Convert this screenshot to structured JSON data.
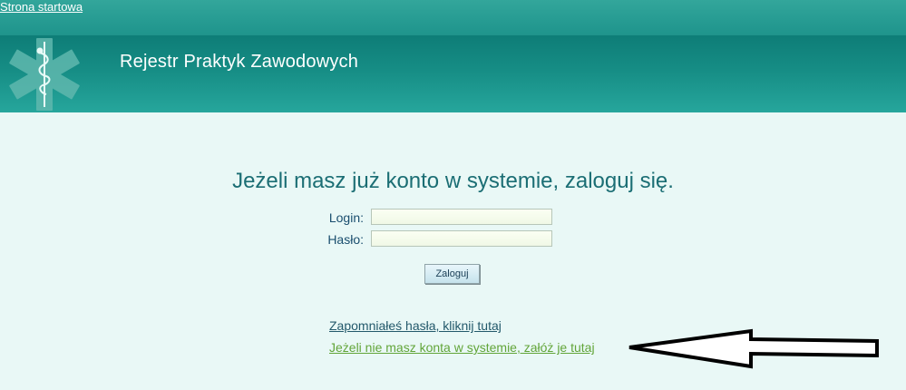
{
  "header": {
    "home_link": "Strona startowa",
    "title": "Rejestr Praktyk Zawodowych",
    "logo_icon": "star-of-life-icon"
  },
  "login": {
    "heading": "Jeżeli masz już konto w systemie, zaloguj się.",
    "login_label": "Login:",
    "login_value": "",
    "password_label": "Hasło:",
    "password_value": "",
    "submit_label": "Zaloguj"
  },
  "links": {
    "forgot_password": "Zapomniałeś hasła, kliknij tutaj",
    "register": "Jeżeli nie masz konta w systemie, załóż je tutaj"
  },
  "annotation": {
    "arrow_icon": "left-arrow-icon"
  },
  "colors": {
    "banner": "#168d85",
    "background": "#e9f8f6",
    "heading": "#1b6e74",
    "register_link": "#62a539"
  }
}
